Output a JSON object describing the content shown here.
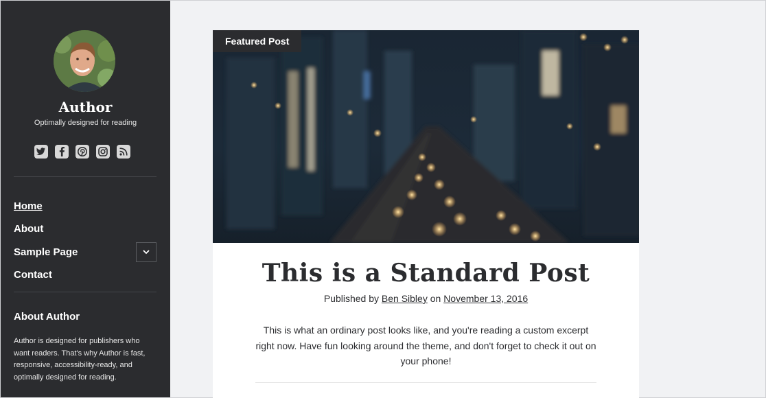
{
  "sidebar": {
    "site_title": "Author",
    "tagline": "Optimally designed for reading",
    "social_icons": [
      "twitter-icon",
      "facebook-icon",
      "pinterest-icon",
      "instagram-icon",
      "rss-icon"
    ],
    "nav": [
      {
        "label": "Home",
        "current": true
      },
      {
        "label": "About"
      },
      {
        "label": "Sample Page",
        "has_submenu": true
      },
      {
        "label": "Contact"
      }
    ],
    "widget": {
      "title": "About Author",
      "text": "Author is designed for publishers who want readers. That's why Author is fast, responsive, accessibility-ready, and optimally designed for reading."
    }
  },
  "post": {
    "badge": "Featured Post",
    "title": "This is a Standard Post",
    "meta_prefix": "Published by",
    "author": "Ben Sibley",
    "meta_on": "on",
    "date": "November 13, 2016",
    "excerpt": "This is what an ordinary post looks like, and you're reading a custom excerpt right now. Have fun looking around the theme, and don't forget to check it out on your phone!"
  },
  "colors": {
    "sidebar_bg": "#2b2c2f",
    "page_bg": "#f1f2f4",
    "text": "#2b2c2f"
  }
}
